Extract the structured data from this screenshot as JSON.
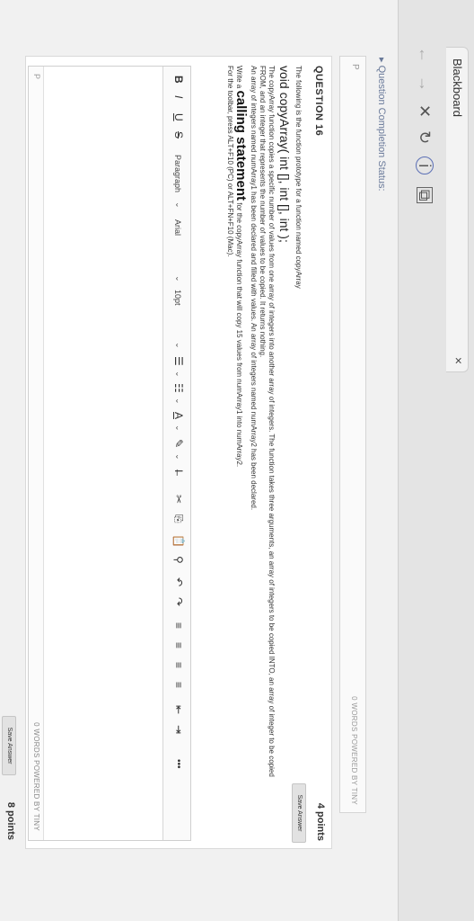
{
  "browser": {
    "tab_title": "Blackboard",
    "tab_close": "×",
    "nav": {
      "back": "←",
      "forward": "→",
      "stop": "✕",
      "refresh": "↻",
      "info": "i",
      "capture": "⧉"
    }
  },
  "status_strip": {
    "text": "▸ Question Completion Status:"
  },
  "prev_editor": {
    "p_label": "P",
    "words": "0 WORDS  POWERED BY TINY"
  },
  "question": {
    "title": "QUESTION 16",
    "points": "4 points",
    "save_label": "Save Answer",
    "intro": "The following is the function prototype for a function named copyArray",
    "prototype": "void copyArray( int [], int [], int );",
    "desc1": "The copyArray function copies a specific number of values from one array of integers into another array of integers. The function takes three arguments, an array of integers to be copied INTO, an array of integer to be copied",
    "desc2": "FROM, and an integer that represents the number of values to be copied. It returns nothing.",
    "desc3": "An array of integers named numArray1 has been declared and filled with values. An array of integers named numArray2 has been declared.",
    "task_prefix": "Write a",
    "task_big": "calling statement",
    "task_suffix": "for the copyArray function that will copy 15 values from numArray1 into numArray2.",
    "toolbar_hint": "For the toolbar, press ALT+F10 (PC) or ALT+FN+F10 (Mac)."
  },
  "toolbar": {
    "bold": "B",
    "italic": "I",
    "underline": "U",
    "strike": "S",
    "paragraph": "Paragraph",
    "font": "Arial",
    "size": "10pt",
    "bullets": "☰",
    "numbering": "☷",
    "text_color": "A",
    "highlight": "✎",
    "clear_format": "I̶",
    "cut": "✂",
    "copy": "⎘",
    "paste": "📋",
    "find": "⚲",
    "undo": "↶",
    "redo": "↷",
    "align_left": "≡",
    "align_center": "≡",
    "align_right": "≡",
    "justify": "≡",
    "indent": "⇥",
    "outdent": "⇤",
    "more": "•••",
    "chevron": "⌄"
  },
  "editor_status": {
    "p_label": "P",
    "words": "0 WORDS  POWERED BY TINY"
  },
  "next_question": {
    "points": "8 points",
    "save_label": "Save Answer"
  }
}
